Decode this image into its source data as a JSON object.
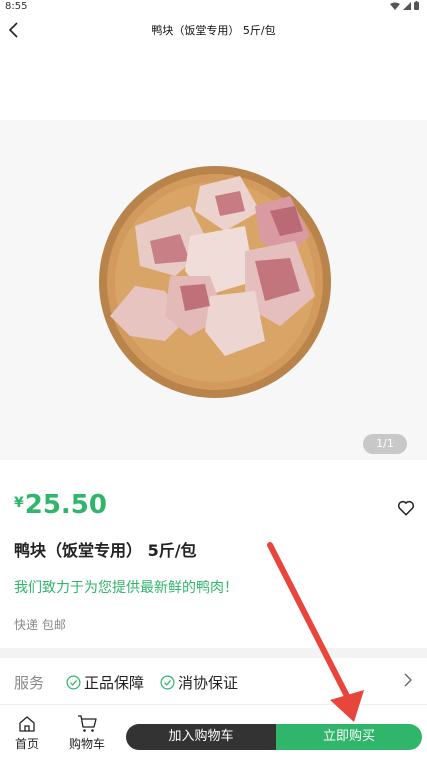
{
  "status_bar": {
    "time": "8:55"
  },
  "header": {
    "title": "鸭块（饭堂专用） 5斤/包"
  },
  "gallery": {
    "pager": "1/1"
  },
  "product": {
    "price_symbol": "¥",
    "price": "25.50",
    "name": "鸭块（饭堂专用） 5斤/包",
    "slogan": "我们致力于为您提供最新鲜的鸭肉！",
    "shipping": "快递 包邮"
  },
  "service": {
    "label": "服务",
    "items": [
      "正品保障",
      "消协保证"
    ]
  },
  "tabbar": {
    "home": "首页",
    "cart": "购物车",
    "add_to_cart": "加入购物车",
    "buy_now": "立即购买"
  },
  "colors": {
    "accent": "#2fb66b",
    "dark_button": "#333333",
    "annotation": "#e8453c"
  }
}
